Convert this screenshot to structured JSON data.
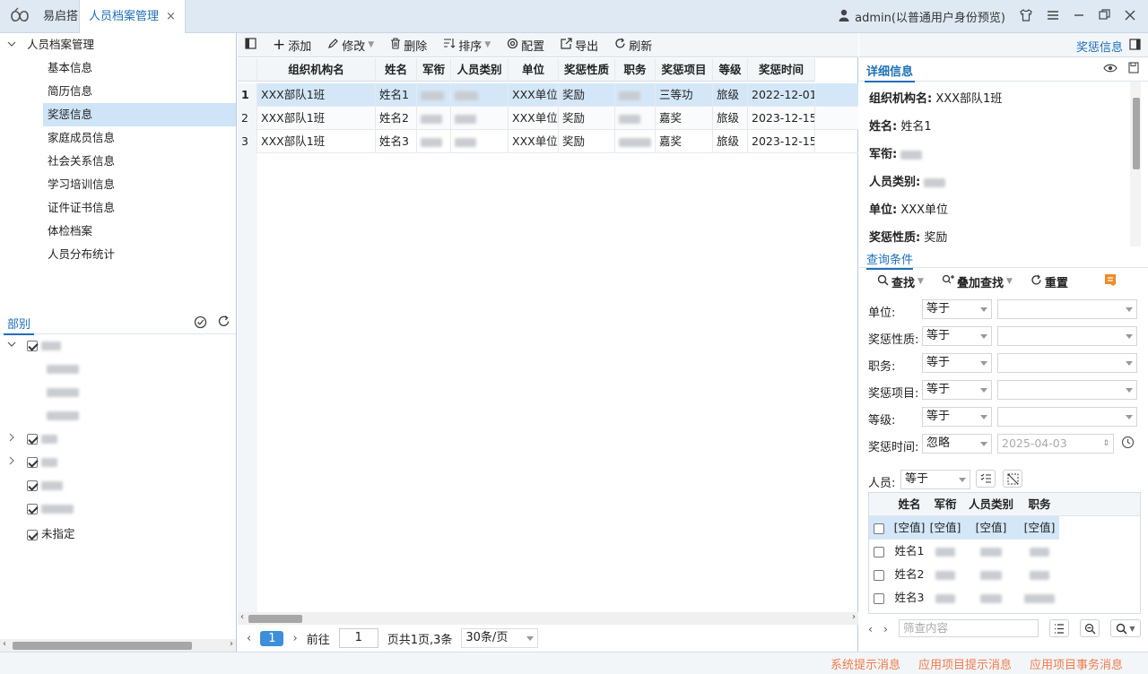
{
  "app": {
    "name": "易启搭",
    "tab_label": "人员档案管理",
    "tab_close": "×"
  },
  "topbar": {
    "user_label": "admin(以普通用户身份预览)"
  },
  "left_tree": {
    "root": "人员档案管理",
    "items": [
      "基本信息",
      "简历信息",
      "奖惩信息",
      "家庭成员信息",
      "社会关系信息",
      "学习培训信息",
      "证件证书信息",
      "体检档案",
      "人员分布统计"
    ],
    "selected": "奖惩信息"
  },
  "dept_panel": {
    "title": "部别",
    "unassigned": "未指定"
  },
  "toolbar": {
    "add": "添加",
    "edit": "修改",
    "delete": "删除",
    "sort": "排序",
    "config": "配置",
    "export": "导出",
    "refresh": "刷新",
    "right_label": "奖惩信息"
  },
  "grid": {
    "headers": [
      "组织机构名",
      "姓名",
      "军衔",
      "人员类别",
      "单位",
      "奖惩性质",
      "职务",
      "奖惩项目",
      "等级",
      "奖惩时间"
    ],
    "rows": [
      {
        "num": "1",
        "org": "XXX部队1班",
        "name": "姓名1",
        "unit": "XXX单位",
        "nature": "奖励",
        "item": "三等功",
        "level": "旅级",
        "time": "2022-12-01"
      },
      {
        "num": "2",
        "org": "XXX部队1班",
        "name": "姓名2",
        "unit": "XXX单位",
        "nature": "奖励",
        "item": "嘉奖",
        "level": "旅级",
        "time": "2023-12-15"
      },
      {
        "num": "3",
        "org": "XXX部队1班",
        "name": "姓名3",
        "unit": "XXX单位",
        "nature": "奖励",
        "item": "嘉奖",
        "level": "旅级",
        "time": "2023-12-15"
      }
    ]
  },
  "pager": {
    "current_page": "1",
    "goto_label": "前往",
    "goto_value": "1",
    "summary": "页共1页,3条",
    "page_size": "30条/页"
  },
  "detail": {
    "tab": "详细信息",
    "org_label": "组织机构名:",
    "org_value": "XXX部队1班",
    "name_label": "姓名:",
    "name_value": "姓名1",
    "rank_label": "军衔:",
    "category_label": "人员类别:",
    "unit_label": "单位:",
    "unit_value": "XXX单位",
    "nature_label": "奖惩性质:",
    "nature_value": "奖励"
  },
  "query": {
    "tab": "查询条件",
    "find": "查找",
    "add_find": "叠加查找",
    "reset": "重置",
    "conditions": [
      {
        "label": "单位:",
        "op": "等于"
      },
      {
        "label": "奖惩性质:",
        "op": "等于"
      },
      {
        "label": "职务:",
        "op": "等于"
      },
      {
        "label": "奖惩项目:",
        "op": "等于"
      },
      {
        "label": "等级:",
        "op": "等于"
      },
      {
        "label": "奖惩时间:",
        "op": "忽略",
        "date_placeholder": "2025-04-03"
      }
    ],
    "person_label": "人员:",
    "person_op": "等于",
    "person_headers": [
      "姓名",
      "军衔",
      "人员类别",
      "职务"
    ],
    "person_empty": "[空值]",
    "person_rows": [
      "姓名1",
      "姓名2",
      "姓名3"
    ],
    "filter_placeholder": "筛查内容"
  },
  "status": {
    "sys_msg": "系统提示消息",
    "app_msg": "应用项目提示消息",
    "app_task": "应用项目事务消息"
  },
  "colors": {
    "accent": "#1e6fb8",
    "selection": "#d4e7f8",
    "status_text": "#ef7b4c"
  }
}
